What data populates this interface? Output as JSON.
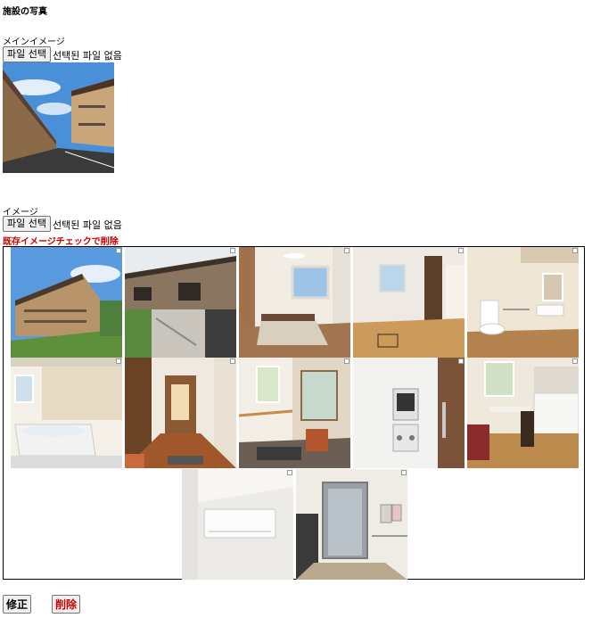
{
  "page": {
    "title": "施設の写真"
  },
  "main_image": {
    "label": "メインイメージ",
    "file_button": "파일 선택",
    "file_status": "선택된 파일 없음"
  },
  "images": {
    "label": "イメージ",
    "file_button": "파일 선택",
    "file_status": "선택된 파일 없음",
    "delete_hint": "既存イメージチェックで削除",
    "colors": {
      "hint": "#cc0000"
    }
  },
  "actions": {
    "edit_label": "修正",
    "delete_label": "削除",
    "delete_color": "#cc0000"
  }
}
